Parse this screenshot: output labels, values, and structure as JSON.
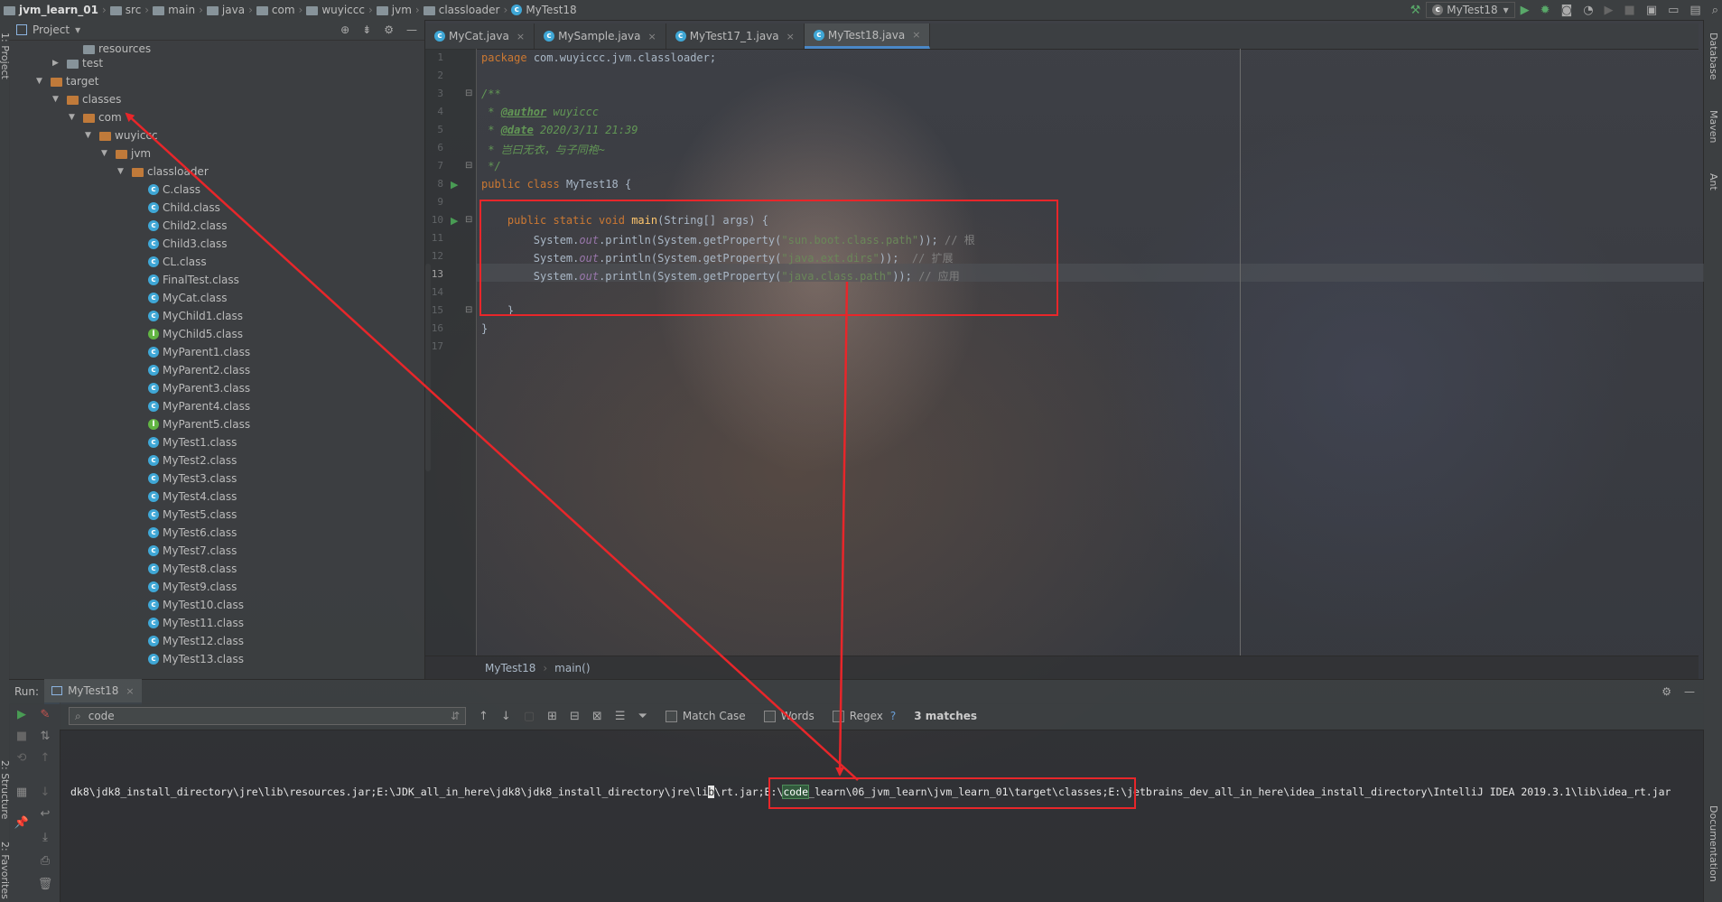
{
  "breadcrumb": [
    "jvm_learn_01",
    "src",
    "main",
    "java",
    "com",
    "wuyiccc",
    "jvm",
    "classloader",
    "MyTest18"
  ],
  "run_config": "MyTest18",
  "sidebar_left_labels": [
    "1: Project",
    "2: Structure",
    "2: Favorites"
  ],
  "sidebar_right_labels": [
    "Database",
    "Maven",
    "Ant",
    "Documentation"
  ],
  "project_panel": {
    "title": "Project",
    "tree": [
      {
        "label": "resources",
        "depth": 3,
        "type": "folder"
      },
      {
        "label": "test",
        "depth": 2,
        "type": "folder",
        "arrow": "▶"
      },
      {
        "label": "target",
        "depth": 1,
        "type": "folder-orange",
        "arrow": "▼"
      },
      {
        "label": "classes",
        "depth": 2,
        "type": "folder-orange",
        "arrow": "▼"
      },
      {
        "label": "com",
        "depth": 3,
        "type": "folder-orange",
        "arrow": "▼"
      },
      {
        "label": "wuyiccc",
        "depth": 4,
        "type": "folder-orange",
        "arrow": "▼"
      },
      {
        "label": "jvm",
        "depth": 5,
        "type": "folder-orange",
        "arrow": "▼"
      },
      {
        "label": "classloader",
        "depth": 6,
        "type": "folder-orange",
        "arrow": "▼"
      },
      {
        "label": "C.class",
        "depth": 7,
        "type": "class"
      },
      {
        "label": "Child.class",
        "depth": 7,
        "type": "class"
      },
      {
        "label": "Child2.class",
        "depth": 7,
        "type": "class"
      },
      {
        "label": "Child3.class",
        "depth": 7,
        "type": "class"
      },
      {
        "label": "CL.class",
        "depth": 7,
        "type": "class"
      },
      {
        "label": "FinalTest.class",
        "depth": 7,
        "type": "class"
      },
      {
        "label": "MyCat.class",
        "depth": 7,
        "type": "class"
      },
      {
        "label": "MyChild1.class",
        "depth": 7,
        "type": "class"
      },
      {
        "label": "MyChild5.class",
        "depth": 7,
        "type": "interface"
      },
      {
        "label": "MyParent1.class",
        "depth": 7,
        "type": "class"
      },
      {
        "label": "MyParent2.class",
        "depth": 7,
        "type": "class"
      },
      {
        "label": "MyParent3.class",
        "depth": 7,
        "type": "class"
      },
      {
        "label": "MyParent4.class",
        "depth": 7,
        "type": "class"
      },
      {
        "label": "MyParent5.class",
        "depth": 7,
        "type": "interface"
      },
      {
        "label": "MyTest1.class",
        "depth": 7,
        "type": "class"
      },
      {
        "label": "MyTest2.class",
        "depth": 7,
        "type": "class"
      },
      {
        "label": "MyTest3.class",
        "depth": 7,
        "type": "class"
      },
      {
        "label": "MyTest4.class",
        "depth": 7,
        "type": "class"
      },
      {
        "label": "MyTest5.class",
        "depth": 7,
        "type": "class"
      },
      {
        "label": "MyTest6.class",
        "depth": 7,
        "type": "class"
      },
      {
        "label": "MyTest7.class",
        "depth": 7,
        "type": "class"
      },
      {
        "label": "MyTest8.class",
        "depth": 7,
        "type": "class"
      },
      {
        "label": "MyTest9.class",
        "depth": 7,
        "type": "class"
      },
      {
        "label": "MyTest10.class",
        "depth": 7,
        "type": "class"
      },
      {
        "label": "MyTest11.class",
        "depth": 7,
        "type": "class"
      },
      {
        "label": "MyTest12.class",
        "depth": 7,
        "type": "class"
      },
      {
        "label": "MyTest13.class",
        "depth": 7,
        "type": "class"
      }
    ]
  },
  "editor_tabs": [
    {
      "label": "MyCat.java",
      "active": false
    },
    {
      "label": "MySample.java",
      "active": false
    },
    {
      "label": "MyTest17_1.java",
      "active": false
    },
    {
      "label": "MyTest18.java",
      "active": true
    }
  ],
  "code": {
    "line_numbers": [
      "1",
      "2",
      "3",
      "4",
      "5",
      "6",
      "7",
      "8",
      "9",
      "10",
      "11",
      "12",
      "13",
      "14",
      "15",
      "16",
      "17"
    ],
    "package_kw": "package",
    "package_name": "com.wuyiccc.jvm.classloader;",
    "doc_open": "/**",
    "author_tag": "@author",
    "author_val": "wuyiccc",
    "date_tag": "@date",
    "date_val": "2020/3/11 21:39",
    "doc_line3": "* 岂曰无衣，与子同袍~",
    "doc_close": "*/",
    "class_decl_kw": "public class",
    "class_name": "MyTest18",
    "open_brace": "{",
    "main_kw": "public static void",
    "main_name": "main",
    "main_params": "(String[] args) {",
    "sys_prefix": "System.",
    "out_field": "out",
    "println": ".println(System.",
    "getprop": "getProperty",
    "prop1": "\"sun.boot.class.path\"",
    "prop2": "\"java.ext.dirs\"",
    "prop3": "\"java.class.path\"",
    "tail": "));",
    "comment1": "// 根",
    "comment2": "// 扩展",
    "comment3": "// 应用",
    "close_brace": "}"
  },
  "editor_breadcrumb": {
    "class": "MyTest18",
    "method": "main()"
  },
  "run_panel": {
    "label": "Run:",
    "tab": "MyTest18",
    "search_value": "code",
    "match_case": "Match Case",
    "words": "Words",
    "regex": "Regex",
    "help": "?",
    "matches": "3 matches"
  },
  "console": {
    "part1": "dk8\\jdk8_install_directory\\jre\\lib\\resources.jar;E:\\JDK_all_in_here\\jdk8\\jdk8_install_directory\\jre\\li",
    "cursor_char": "b",
    "part2": "\\rt.jar;E:\\",
    "match": "code",
    "part3": "_learn\\06_jvm_learn\\jvm_learn_01\\target\\classes;E:\\jetbrains_dev_all_in_here\\idea_install_directory\\IntelliJ IDEA 2019.3.1\\lib\\idea_rt.jar"
  },
  "annotation_color": "#e8262a"
}
